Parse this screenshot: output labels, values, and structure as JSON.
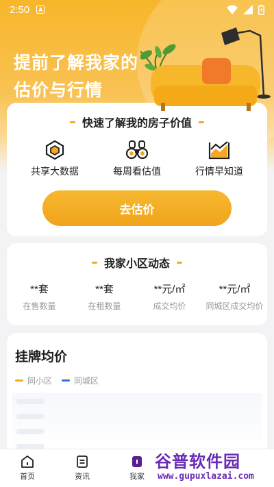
{
  "status": {
    "time": "2:50",
    "notif_badge": "A"
  },
  "hero": {
    "title_line1": "提前了解我家的",
    "title_line2": "估价与行情"
  },
  "valuation_card": {
    "title": "快速了解我的房子价值",
    "features": [
      {
        "icon": "cube-data-icon",
        "label": "共享大数据"
      },
      {
        "icon": "binoculars-icon",
        "label": "每周看估值"
      },
      {
        "icon": "trend-chart-icon",
        "label": "行情早知道"
      }
    ],
    "cta_label": "去估价"
  },
  "community_card": {
    "title": "我家小区动态",
    "stats": [
      {
        "value": "**套",
        "label": "在售数量"
      },
      {
        "value": "**套",
        "label": "在租数量"
      },
      {
        "value": "**元/㎡",
        "label": "成交均价"
      },
      {
        "value": "**元/㎡",
        "label": "同城区成交均价"
      }
    ]
  },
  "listing_price_card": {
    "title": "挂牌均价",
    "legend": [
      {
        "label": "同小区",
        "color": "#f5a623"
      },
      {
        "label": "同城区",
        "color": "#2f6fe0"
      }
    ]
  },
  "tabbar": {
    "tabs": [
      {
        "icon": "home-icon",
        "label": "首页"
      },
      {
        "icon": "news-icon",
        "label": "资讯"
      },
      {
        "icon": "my-home-icon",
        "label": "我家"
      }
    ]
  },
  "watermark": {
    "main": "谷普软件园",
    "sub": "www.gupuxlazai.com"
  },
  "colors": {
    "accent": "#f5a623",
    "cta": "#f0a51b",
    "blue": "#2f6fe0",
    "active_tab": "#5a1f8c"
  }
}
